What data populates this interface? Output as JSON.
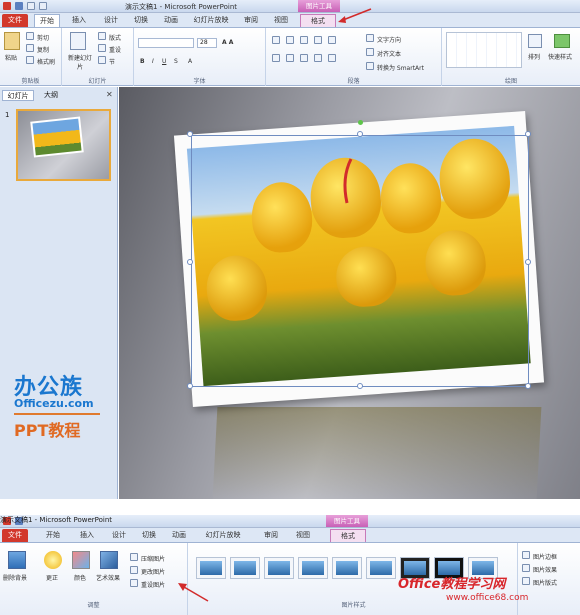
{
  "window": {
    "title": "演示文稿1 - Microsoft PowerPoint",
    "contextual_tab": "图片工具"
  },
  "tabs": [
    "文件",
    "开始",
    "插入",
    "设计",
    "切换",
    "动画",
    "幻灯片放映",
    "审阅",
    "视图",
    "格式"
  ],
  "ribbon": {
    "clipboard": {
      "paste": "粘贴",
      "cut": "剪切",
      "copy": "复制",
      "format_painter": "格式刷",
      "label": "剪贴板"
    },
    "slides": {
      "new_slide": "新建幻灯片",
      "layout": "版式",
      "reset": "重设",
      "section": "节",
      "label": "幻灯片"
    },
    "font": {
      "label": "字体",
      "size_value": "28"
    },
    "paragraph": {
      "text_direction": "文字方向",
      "align_text": "对齐文本",
      "smartart": "转换为 SmartArt",
      "label": "段落"
    },
    "drawing": {
      "arrange": "排列",
      "quick_styles": "快速样式",
      "label": "绘图"
    }
  },
  "left_pane": {
    "tab_slides": "幻灯片",
    "tab_outline": "大纲",
    "slide_number": "1"
  },
  "watermark": {
    "brand": "办公族",
    "site": "Officezu.com",
    "caption": "PPT教程"
  },
  "format_ribbon": {
    "remove_bg": "删除背景",
    "corrections": "更正",
    "color": "颜色",
    "artistic": "艺术效果",
    "compress": "压缩图片",
    "change": "更改图片",
    "reset": "重设图片",
    "adjust_label": "调整",
    "styles_label": "图片样式",
    "picture_border": "图片边框",
    "picture_effects": "图片效果",
    "picture_layout": "图片版式"
  },
  "bottom_watermark": {
    "brand": "Office教程学习网",
    "site": "www.office68.com"
  },
  "colors": {
    "file_tab": "#d2382c",
    "picture_tools": "#c860b6",
    "accent_red": "#d22b2b"
  }
}
